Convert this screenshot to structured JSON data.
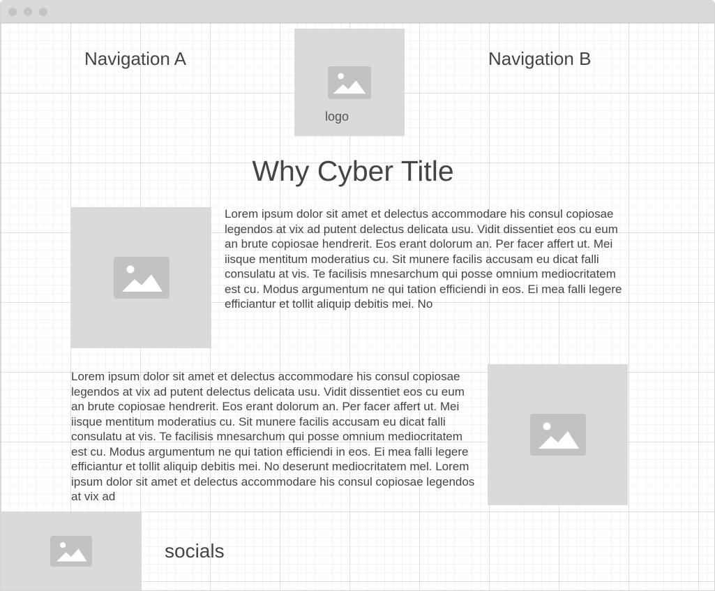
{
  "header": {
    "nav_a": "Navigation A",
    "nav_b": "Navigation B",
    "logo_label": "logo"
  },
  "main": {
    "title": "Why Cyber Title",
    "section1_text": "Lorem ipsum dolor sit amet et delectus accommodare his consul copiosae legendos at vix ad putent delectus delicata usu. Vidit dissentiet eos cu eum an brute copiosae hendrerit. Eos erant dolorum an. Per facer affert ut. Mei iisque mentitum moderatius cu. Sit munere facilis accusam eu dicat falli consulatu at vis. Te facilisis mnesarchum qui posse omnium mediocritatem est cu. Modus argumentum ne qui tation efficiendi in eos. Ei mea falli legere efficiantur et tollit aliquip debitis mei. No",
    "section2_text": "Lorem ipsum dolor sit amet et delectus accommodare his consul copiosae legendos at vix ad putent delectus delicata usu. Vidit dissentiet eos cu eum an brute copiosae hendrerit. Eos erant dolorum an. Per facer affert ut. Mei iisque mentitum moderatius cu. Sit munere facilis accusam eu dicat falli consulatu at vis. Te facilisis mnesarchum qui posse omnium mediocritatem est cu. Modus argumentum ne qui tation efficiendi in eos. Ei mea falli legere efficiantur et tollit aliquip debitis mei. No deserunt mediocritatem mel. Lorem ipsum dolor sit amet et delectus accommodare his consul copiosae legendos at vix ad"
  },
  "footer": {
    "socials_label": "socials"
  },
  "icons": {
    "image_placeholder": "image-placeholder-icon"
  },
  "colors": {
    "titlebar": "#dadada",
    "placeholder_bg": "#dadada",
    "placeholder_icon": "#c2c2c2",
    "text": "#444444",
    "grid_line": "#e4e4e4"
  }
}
